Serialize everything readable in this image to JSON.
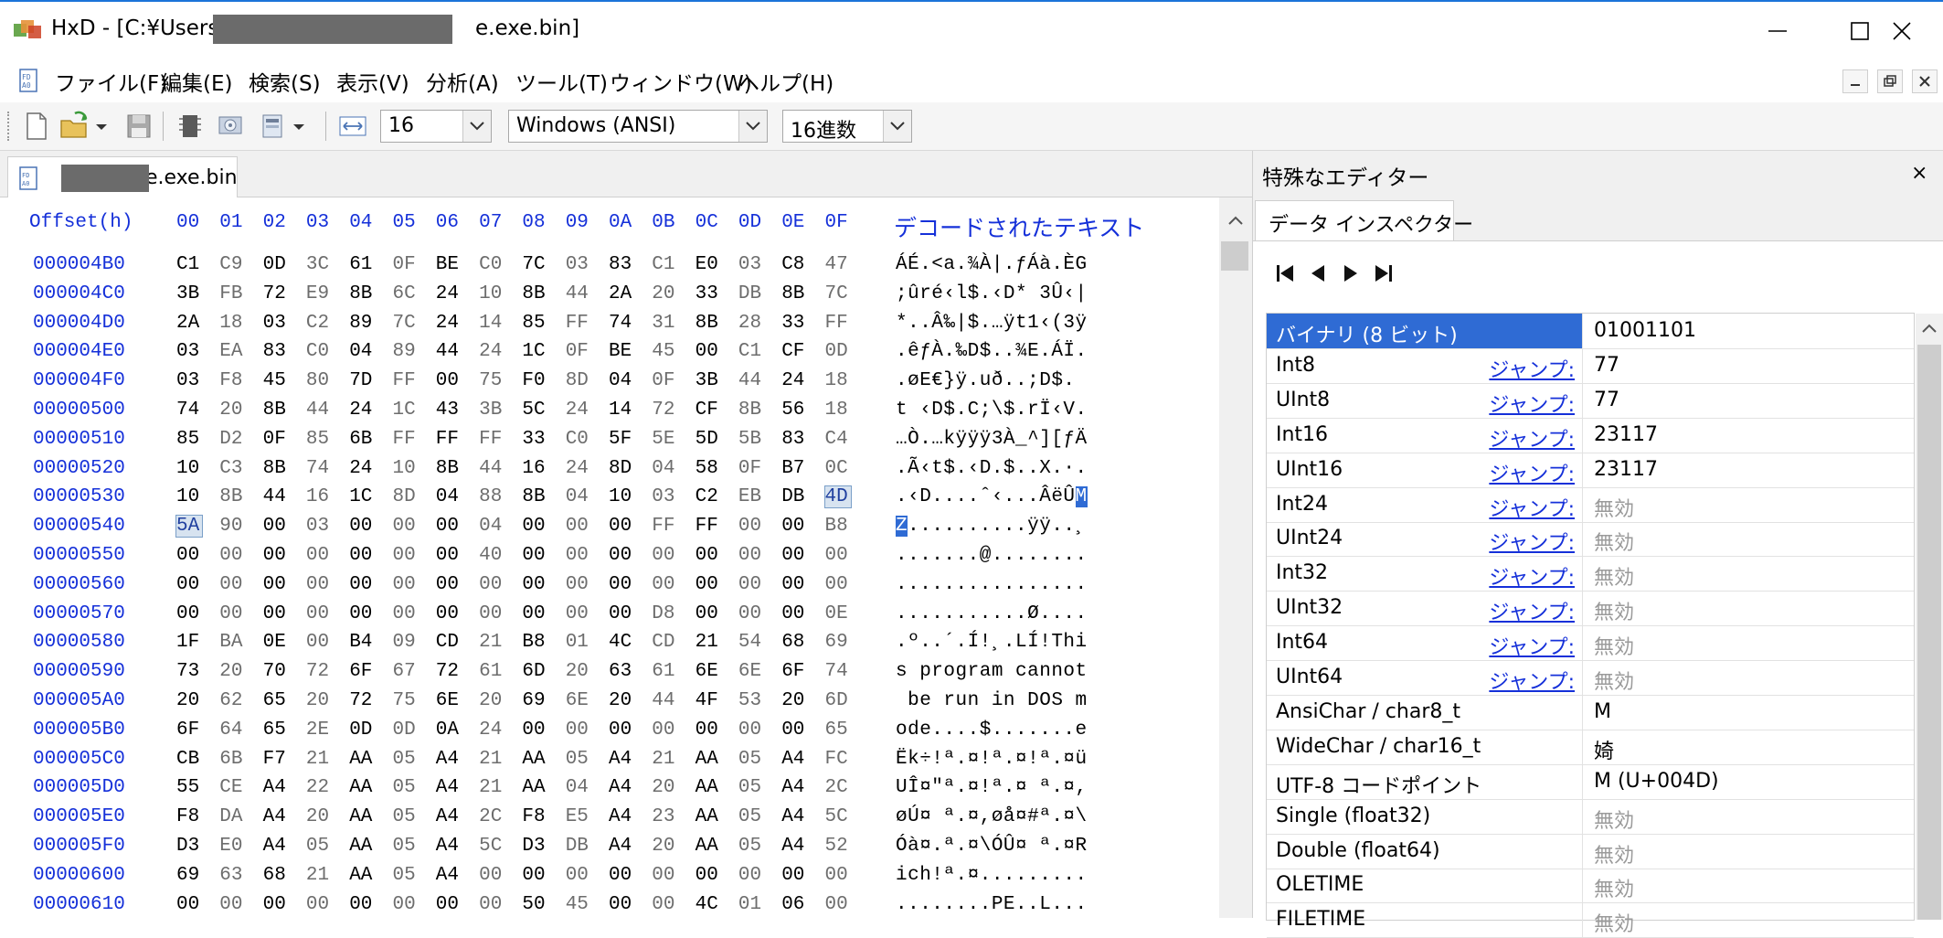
{
  "titlebar": {
    "app": "HxD",
    "title": "HxD - [C:¥Users¥",
    "title_suffix": "e.exe.bin]"
  },
  "menu": [
    "ファイル(F)",
    "編集(E)",
    "検索(S)",
    "表示(V)",
    "分析(A)",
    "ツール(T)",
    "ウィンドウ(W)",
    "ヘルプ(H)"
  ],
  "toolbar": {
    "bytes_per_row": "16",
    "charset": "Windows (ANSI)",
    "offset_base": "16進数"
  },
  "document_tab": {
    "label": "e.exe.bin"
  },
  "hex": {
    "offset_header": "Offset(h)",
    "columns": [
      "00",
      "01",
      "02",
      "03",
      "04",
      "05",
      "06",
      "07",
      "08",
      "09",
      "0A",
      "0B",
      "0C",
      "0D",
      "0E",
      "0F"
    ],
    "decoded_header": "デコードされたテキスト",
    "rows": [
      {
        "offset": "000004B0",
        "bytes": [
          "C1",
          "C9",
          "0D",
          "3C",
          "61",
          "0F",
          "BE",
          "C0",
          "7C",
          "03",
          "83",
          "C1",
          "E0",
          "03",
          "C8",
          "47"
        ],
        "ascii": "ÁÉ.<a.¾À|.ƒÁà.ÈG"
      },
      {
        "offset": "000004C0",
        "bytes": [
          "3B",
          "FB",
          "72",
          "E9",
          "8B",
          "6C",
          "24",
          "10",
          "8B",
          "44",
          "2A",
          "20",
          "33",
          "DB",
          "8B",
          "7C"
        ],
        "ascii": ";ûré‹l$.‹D* 3Û‹|"
      },
      {
        "offset": "000004D0",
        "bytes": [
          "2A",
          "18",
          "03",
          "C2",
          "89",
          "7C",
          "24",
          "14",
          "85",
          "FF",
          "74",
          "31",
          "8B",
          "28",
          "33",
          "FF"
        ],
        "ascii": "*..Â‰|$.…ÿt1‹(3ÿ"
      },
      {
        "offset": "000004E0",
        "bytes": [
          "03",
          "EA",
          "83",
          "C0",
          "04",
          "89",
          "44",
          "24",
          "1C",
          "0F",
          "BE",
          "45",
          "00",
          "C1",
          "CF",
          "0D"
        ],
        "ascii": ".êƒÀ.‰D$..¾E.ÁÏ."
      },
      {
        "offset": "000004F0",
        "bytes": [
          "03",
          "F8",
          "45",
          "80",
          "7D",
          "FF",
          "00",
          "75",
          "F0",
          "8D",
          "04",
          "0F",
          "3B",
          "44",
          "24",
          "18"
        ],
        "ascii": ".øE€}ÿ.uð..;D$."
      },
      {
        "offset": "00000500",
        "bytes": [
          "74",
          "20",
          "8B",
          "44",
          "24",
          "1C",
          "43",
          "3B",
          "5C",
          "24",
          "14",
          "72",
          "CF",
          "8B",
          "56",
          "18"
        ],
        "ascii": "t ‹D$.C;\\$.rÏ‹V."
      },
      {
        "offset": "00000510",
        "bytes": [
          "85",
          "D2",
          "0F",
          "85",
          "6B",
          "FF",
          "FF",
          "FF",
          "33",
          "C0",
          "5F",
          "5E",
          "5D",
          "5B",
          "83",
          "C4"
        ],
        "ascii": "…Ò.…kÿÿÿ3À_^][ƒÄ"
      },
      {
        "offset": "00000520",
        "bytes": [
          "10",
          "C3",
          "8B",
          "74",
          "24",
          "10",
          "8B",
          "44",
          "16",
          "24",
          "8D",
          "04",
          "58",
          "0F",
          "B7",
          "0C"
        ],
        "ascii": ".Ã‹t$.‹D.$..X.·."
      },
      {
        "offset": "00000530",
        "bytes": [
          "10",
          "8B",
          "44",
          "16",
          "1C",
          "8D",
          "04",
          "88",
          "8B",
          "04",
          "10",
          "03",
          "C2",
          "EB",
          "DB",
          "4D"
        ],
        "ascii": ".‹D....ˆ‹...ÂëÛ",
        "ascii_sel": "M"
      },
      {
        "offset": "00000540",
        "bytes": [
          "5A",
          "90",
          "00",
          "03",
          "00",
          "00",
          "00",
          "04",
          "00",
          "00",
          "00",
          "FF",
          "FF",
          "00",
          "00",
          "B8"
        ],
        "ascii_sel_start": "Z",
        "ascii": "..........ÿÿ..¸"
      },
      {
        "offset": "00000550",
        "bytes": [
          "00",
          "00",
          "00",
          "00",
          "00",
          "00",
          "00",
          "40",
          "00",
          "00",
          "00",
          "00",
          "00",
          "00",
          "00",
          "00"
        ],
        "ascii": ".......@........"
      },
      {
        "offset": "00000560",
        "bytes": [
          "00",
          "00",
          "00",
          "00",
          "00",
          "00",
          "00",
          "00",
          "00",
          "00",
          "00",
          "00",
          "00",
          "00",
          "00",
          "00"
        ],
        "ascii": "................"
      },
      {
        "offset": "00000570",
        "bytes": [
          "00",
          "00",
          "00",
          "00",
          "00",
          "00",
          "00",
          "00",
          "00",
          "00",
          "00",
          "D8",
          "00",
          "00",
          "00",
          "0E"
        ],
        "ascii": "...........Ø...."
      },
      {
        "offset": "00000580",
        "bytes": [
          "1F",
          "BA",
          "0E",
          "00",
          "B4",
          "09",
          "CD",
          "21",
          "B8",
          "01",
          "4C",
          "CD",
          "21",
          "54",
          "68",
          "69"
        ],
        "ascii": ".º..´.Í!¸.LÍ!Thi"
      },
      {
        "offset": "00000590",
        "bytes": [
          "73",
          "20",
          "70",
          "72",
          "6F",
          "67",
          "72",
          "61",
          "6D",
          "20",
          "63",
          "61",
          "6E",
          "6E",
          "6F",
          "74"
        ],
        "ascii": "s program cannot"
      },
      {
        "offset": "000005A0",
        "bytes": [
          "20",
          "62",
          "65",
          "20",
          "72",
          "75",
          "6E",
          "20",
          "69",
          "6E",
          "20",
          "44",
          "4F",
          "53",
          "20",
          "6D"
        ],
        "ascii": " be run in DOS m"
      },
      {
        "offset": "000005B0",
        "bytes": [
          "6F",
          "64",
          "65",
          "2E",
          "0D",
          "0D",
          "0A",
          "24",
          "00",
          "00",
          "00",
          "00",
          "00",
          "00",
          "00",
          "65"
        ],
        "ascii": "ode....$.......e"
      },
      {
        "offset": "000005C0",
        "bytes": [
          "CB",
          "6B",
          "F7",
          "21",
          "AA",
          "05",
          "A4",
          "21",
          "AA",
          "05",
          "A4",
          "21",
          "AA",
          "05",
          "A4",
          "FC"
        ],
        "ascii": "Ëk÷!ª.¤!ª.¤!ª.¤ü"
      },
      {
        "offset": "000005D0",
        "bytes": [
          "55",
          "CE",
          "A4",
          "22",
          "AA",
          "05",
          "A4",
          "21",
          "AA",
          "04",
          "A4",
          "20",
          "AA",
          "05",
          "A4",
          "2C"
        ],
        "ascii": "UÎ¤\"ª.¤!ª.¤ ª.¤,"
      },
      {
        "offset": "000005E0",
        "bytes": [
          "F8",
          "DA",
          "A4",
          "20",
          "AA",
          "05",
          "A4",
          "2C",
          "F8",
          "E5",
          "A4",
          "23",
          "AA",
          "05",
          "A4",
          "5C"
        ],
        "ascii": "øÚ¤ ª.¤,øå¤#ª.¤\\"
      },
      {
        "offset": "000005F0",
        "bytes": [
          "D3",
          "E0",
          "A4",
          "05",
          "AA",
          "05",
          "A4",
          "5C",
          "D3",
          "DB",
          "A4",
          "20",
          "AA",
          "05",
          "A4",
          "52"
        ],
        "ascii": "Óà¤.ª.¤\\ÓÛ¤ ª.¤R"
      },
      {
        "offset": "00000600",
        "bytes": [
          "69",
          "63",
          "68",
          "21",
          "AA",
          "05",
          "A4",
          "00",
          "00",
          "00",
          "00",
          "00",
          "00",
          "00",
          "00",
          "00"
        ],
        "ascii": "ich!ª.¤........."
      },
      {
        "offset": "00000610",
        "bytes": [
          "00",
          "00",
          "00",
          "00",
          "00",
          "00",
          "00",
          "00",
          "50",
          "45",
          "00",
          "00",
          "4C",
          "01",
          "06",
          "00"
        ],
        "ascii": "........PE..L..."
      }
    ]
  },
  "panel": {
    "title": "特殊なエディター",
    "close": "×",
    "tab": "データ インスペクター",
    "jump": "ジャンプ:",
    "rows": [
      {
        "name": "バイナリ (8 ビット)",
        "value": "01001101",
        "jump": false,
        "active": true
      },
      {
        "name": "Int8",
        "value": "77",
        "jump": true
      },
      {
        "name": "UInt8",
        "value": "77",
        "jump": true
      },
      {
        "name": "Int16",
        "value": "23117",
        "jump": true
      },
      {
        "name": "UInt16",
        "value": "23117",
        "jump": true
      },
      {
        "name": "Int24",
        "value": "無効",
        "jump": true,
        "disabled": true
      },
      {
        "name": "UInt24",
        "value": "無効",
        "jump": true,
        "disabled": true
      },
      {
        "name": "Int32",
        "value": "無効",
        "jump": true,
        "disabled": true
      },
      {
        "name": "UInt32",
        "value": "無効",
        "jump": true,
        "disabled": true
      },
      {
        "name": "Int64",
        "value": "無効",
        "jump": true,
        "disabled": true
      },
      {
        "name": "UInt64",
        "value": "無効",
        "jump": true,
        "disabled": true
      },
      {
        "name": "AnsiChar / char8_t",
        "value": "M",
        "jump": false
      },
      {
        "name": "WideChar / char16_t",
        "value": "婍",
        "jump": false
      },
      {
        "name": "UTF-8 コードポイント",
        "value": "M (U+004D)",
        "jump": false
      },
      {
        "name": "Single (float32)",
        "value": "無効",
        "jump": false,
        "disabled": true
      },
      {
        "name": "Double (float64)",
        "value": "無効",
        "jump": false,
        "disabled": true
      },
      {
        "name": "OLETIME",
        "value": "無効",
        "jump": false,
        "disabled": true
      },
      {
        "name": "FILETIME",
        "value": "無効",
        "jump": false,
        "disabled": true
      }
    ]
  },
  "colors": {
    "offset_blue": "#1530d9",
    "selection": "#2f6bd4",
    "disabled": "#9a9a9a"
  }
}
